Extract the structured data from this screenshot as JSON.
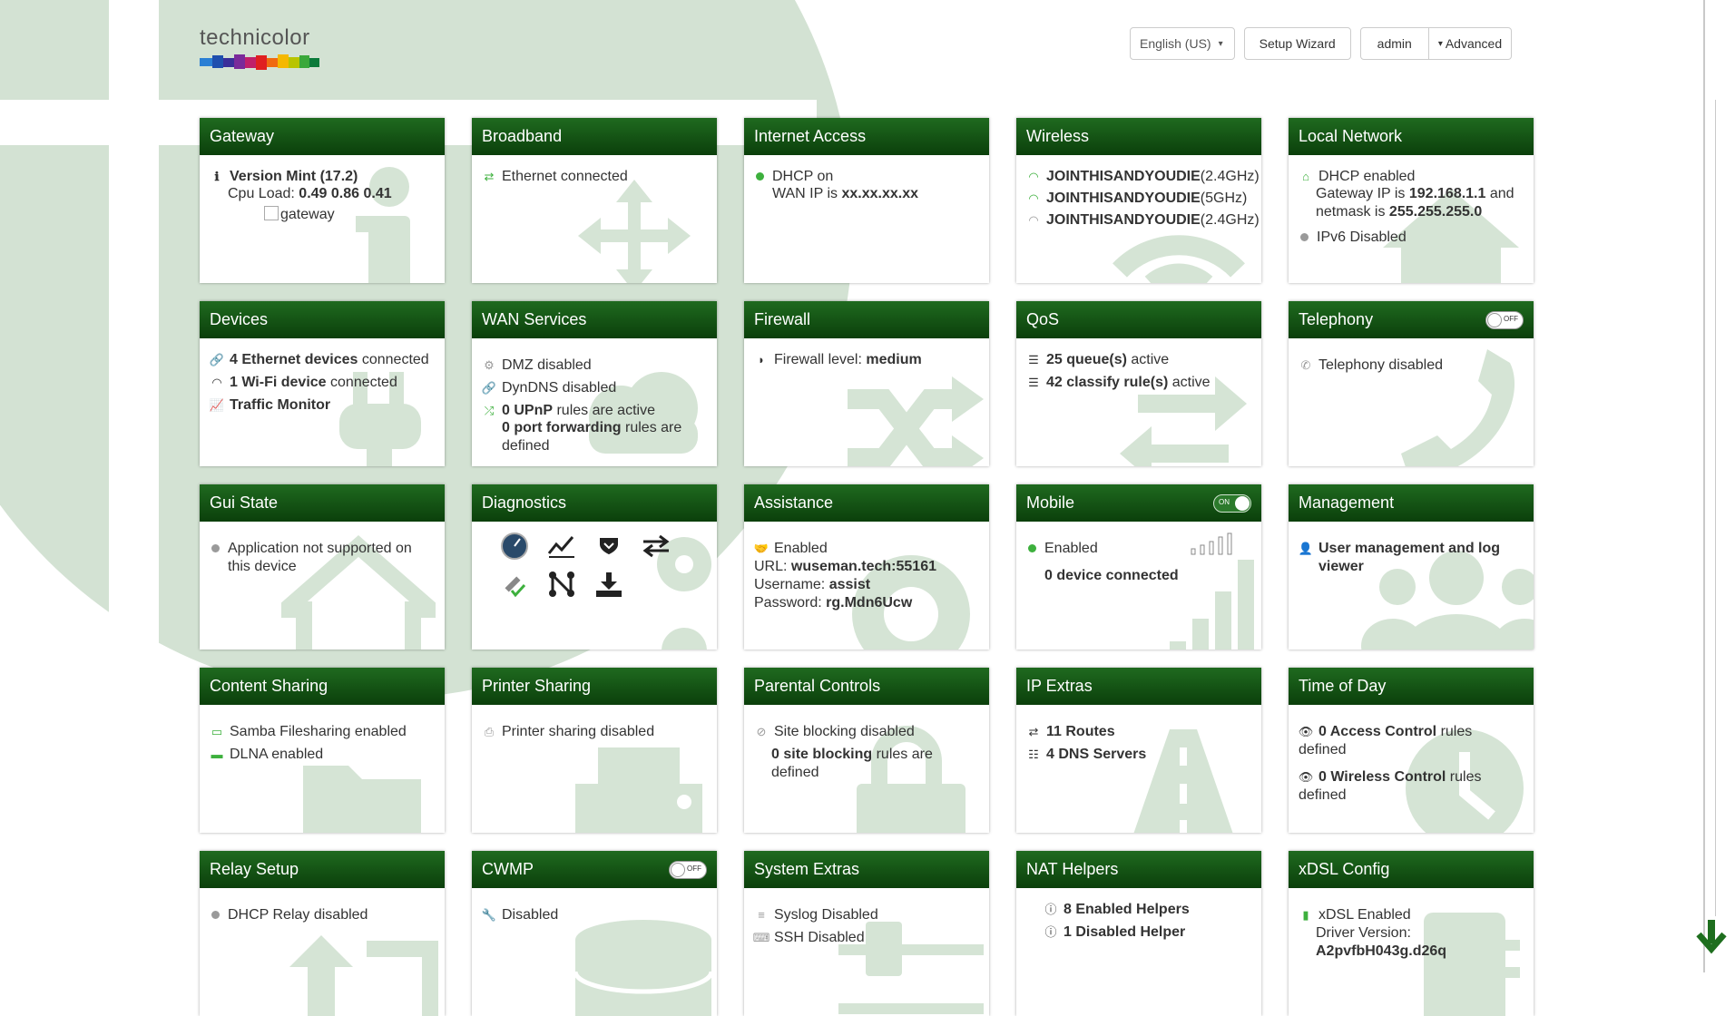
{
  "brand": {
    "logo_text": "technicolor"
  },
  "topnav": {
    "language": "English (US)",
    "setup_wizard": "Setup Wizard",
    "user": "admin",
    "advanced": "Advanced"
  },
  "colors": {
    "header_green": "#0b3f0b",
    "watermark_green": "#d1e0d1",
    "status_green": "#3db03d"
  },
  "cards": {
    "gateway": {
      "title": "Gateway",
      "version_label": "Version Mint (17.2)",
      "cpu_label": "Cpu Load:",
      "cpu_value": "0.49 0.86 0.41",
      "image_alt": "gateway"
    },
    "broadband": {
      "title": "Broadband",
      "status": "Ethernet connected"
    },
    "internet": {
      "title": "Internet Access",
      "dhcp": "DHCP on",
      "wan_label": "WAN IP is",
      "wan_value": "xx.xx.xx.xx"
    },
    "wireless": {
      "title": "Wireless",
      "networks": [
        {
          "ssid": "JOINTHISANDYOUDIE",
          "band": "(2.4GHz)"
        },
        {
          "ssid": "JOINTHISANDYOUDIE",
          "band": "(5GHz)"
        },
        {
          "ssid": "JOINTHISANDYOUDIE",
          "band": "(2.4GHz)"
        }
      ]
    },
    "local_network": {
      "title": "Local Network",
      "dhcp": "DHCP enabled",
      "gw_label": "Gateway IP is",
      "gw_value": "192.168.1.1",
      "and_netmask": "and netmask is",
      "netmask_value": "255.255.255.0",
      "ipv6": "IPv6 Disabled"
    },
    "devices": {
      "title": "Devices",
      "eth_count": "4 Ethernet devices",
      "eth_suffix": "connected",
      "wifi_count": "1 Wi-Fi device",
      "wifi_suffix": "connected",
      "traffic": "Traffic Monitor"
    },
    "wan_services": {
      "title": "WAN Services",
      "dmz": "DMZ disabled",
      "dyndns": "DynDNS disabled",
      "upnp_bold": "0 UPnP",
      "upnp_rest": "rules are active",
      "pf_bold": "0 port forwarding",
      "pf_rest": "rules are defined"
    },
    "firewall": {
      "title": "Firewall",
      "label": "Firewall level:",
      "value": "medium"
    },
    "qos": {
      "title": "QoS",
      "queues_bold": "25 queue(s)",
      "queues_rest": "active",
      "classify_bold": "42 classify rule(s)",
      "classify_rest": "active"
    },
    "telephony": {
      "title": "Telephony",
      "toggle": "OFF",
      "status": "Telephony disabled"
    },
    "gui_state": {
      "title": "Gui State",
      "status": "Application not supported on this device"
    },
    "diagnostics": {
      "title": "Diagnostics"
    },
    "assistance": {
      "title": "Assistance",
      "status": "Enabled",
      "url_label": "URL:",
      "url_value": "wuseman.tech:55161",
      "user_label": "Username:",
      "user_value": "assist",
      "pass_label": "Password:",
      "pass_value": "rg.Mdn6Ucw"
    },
    "mobile": {
      "title": "Mobile",
      "toggle": "ON",
      "status": "Enabled",
      "devices": "0 device connected"
    },
    "management": {
      "title": "Management",
      "link": "User management and log viewer"
    },
    "content_sharing": {
      "title": "Content Sharing",
      "samba": "Samba Filesharing enabled",
      "dlna": "DLNA enabled"
    },
    "printer_sharing": {
      "title": "Printer Sharing",
      "status": "Printer sharing disabled"
    },
    "parental": {
      "title": "Parental Controls",
      "site_blocking": "Site blocking disabled",
      "rules_bold": "0 site blocking",
      "rules_rest": "rules are defined"
    },
    "ip_extras": {
      "title": "IP Extras",
      "routes": "11 Routes",
      "dns": "4 DNS Servers"
    },
    "time_of_day": {
      "title": "Time of Day",
      "access_bold": "0 Access Control",
      "access_rest": "rules defined",
      "wireless_bold": "0 Wireless Control",
      "wireless_rest": "rules defined"
    },
    "relay": {
      "title": "Relay Setup",
      "status": "DHCP Relay disabled"
    },
    "cwmp": {
      "title": "CWMP",
      "toggle": "OFF",
      "status": "Disabled"
    },
    "system_extras": {
      "title": "System Extras",
      "syslog": "Syslog Disabled",
      "ssh": "SSH Disabled"
    },
    "nat_helpers": {
      "title": "NAT Helpers",
      "enabled": "8 Enabled Helpers",
      "disabled": "1 Disabled Helper"
    },
    "xdsl": {
      "title": "xDSL Config",
      "status": "xDSL Enabled",
      "driver_label": "Driver Version:",
      "driver_value": "A2pvfbH043g.d26q"
    }
  }
}
